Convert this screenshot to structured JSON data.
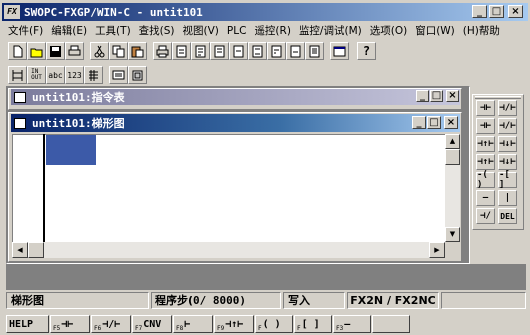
{
  "app": {
    "title": "SWOPC-FXGP/WIN-C - untit101"
  },
  "menu": [
    "文件(F)",
    "编辑(E)",
    "工具(T)",
    "查找(S)",
    "视图(V)",
    "PLC",
    "遥控(R)",
    "监控/调试(M)",
    "选项(O)",
    "窗口(W)",
    "(H)帮助"
  ],
  "toolbar2": {
    "abc": "abc",
    "n123": "123"
  },
  "win_instr": {
    "title": "untit101:指令表"
  },
  "win_ladder": {
    "title": "untit101:梯形图"
  },
  "window_buttons": {
    "min": "_",
    "max": "□",
    "close": "×"
  },
  "palette": {
    "del": "DEL"
  },
  "status": {
    "mode": "梯形图",
    "steps_label": "程序步(",
    "steps_value": "0/ 8000)",
    "write": "写入",
    "plc": "FX2N / FX2NC"
  },
  "fkeys": [
    {
      "sub": "",
      "label": "HELP"
    },
    {
      "sub": "F5",
      "label": "⊣⊢"
    },
    {
      "sub": "F6",
      "label": "⊣/⊢"
    },
    {
      "sub": "F7",
      "label": "CNV"
    },
    {
      "sub": "F8",
      "label": "⊢"
    },
    {
      "sub": "F9",
      "label": "⊣↑⊢"
    },
    {
      "sub": "F",
      "label": "( )"
    },
    {
      "sub": "F",
      "label": "[ ]"
    },
    {
      "sub": "F3",
      "label": "—"
    }
  ],
  "colors": {
    "title_active": "#0a246a",
    "title_inactive": "#7b7b9c",
    "cursor": "#3c5aa8"
  }
}
